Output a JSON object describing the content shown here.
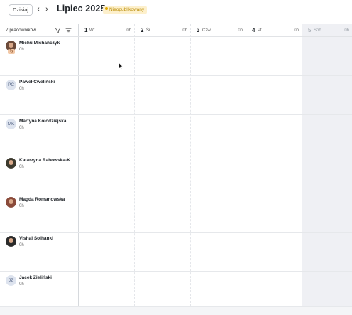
{
  "toolbar": {
    "today_label": "Dzisiaj",
    "prev_icon": "chevron-left-icon",
    "next_icon": "chevron-right-icon",
    "month_title": "Lipiec 2025",
    "status_badge": "Nieopublikowany",
    "status_color": "#e0a800"
  },
  "grid": {
    "employee_count": "7 pracowników",
    "filter_icon": "filter-icon",
    "sort_icon": "sort-icon",
    "days": [
      {
        "num": "1",
        "name": "Wt.",
        "hours": "0h"
      },
      {
        "num": "2",
        "name": "Śr.",
        "hours": "0h"
      },
      {
        "num": "3",
        "name": "Czw.",
        "hours": "0h"
      },
      {
        "num": "4",
        "name": "Pt.",
        "hours": "0h"
      },
      {
        "num": "5",
        "name": "Sob.",
        "hours": "0h"
      }
    ]
  },
  "employees": [
    {
      "name": "Michu Michańczyk",
      "hours": "0h",
      "avatar": "photo",
      "avatar_sub": "Ty"
    },
    {
      "name": "Paweł Ćweliński",
      "hours": "0h",
      "avatar": "PC"
    },
    {
      "name": "Martyna Kołodziejska",
      "hours": "0h",
      "avatar": "MK"
    },
    {
      "name": "Katarzyna Rabowska-Kol...",
      "hours": "0h",
      "avatar": "photo"
    },
    {
      "name": "Magda Romanowska",
      "hours": "0h",
      "avatar": "photo"
    },
    {
      "name": "Vishal Solhanki",
      "hours": "0h",
      "avatar": "photo"
    },
    {
      "name": "Jacek Zieliński",
      "hours": "0h",
      "avatar": "JZ"
    }
  ]
}
